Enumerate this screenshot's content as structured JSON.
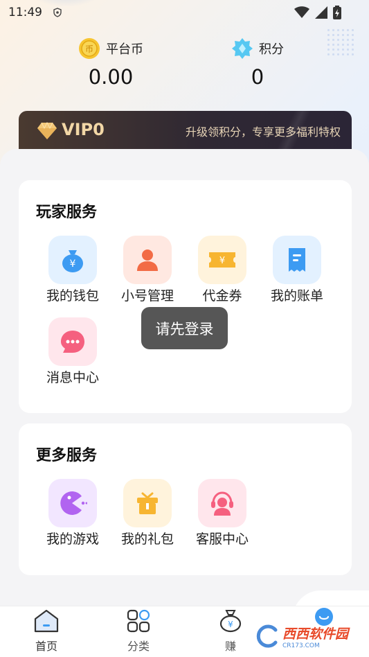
{
  "status_bar": {
    "time": "11:49"
  },
  "stats": {
    "coins": {
      "label": "平台币",
      "value": "0.00",
      "icon": "coin-icon"
    },
    "points": {
      "label": "积分",
      "value": "0",
      "icon": "diamond-badge-icon"
    }
  },
  "vip": {
    "level": "VIP0",
    "slogan": "升级领积分，专享更多福利特权",
    "icon": "diamond-icon"
  },
  "player_services": {
    "title": "玩家服务",
    "items": [
      {
        "label": "我的钱包",
        "icon": "wallet-icon",
        "color": "#e3f1ff"
      },
      {
        "label": "小号管理",
        "icon": "user-icon",
        "color": "#ffe8e1"
      },
      {
        "label": "代金券",
        "icon": "coupon-icon",
        "color": "#fff3dc"
      },
      {
        "label": "我的账单",
        "icon": "bill-icon",
        "color": "#e3f1ff"
      },
      {
        "label": "消息中心",
        "icon": "message-icon",
        "color": "#ffe6ec"
      }
    ]
  },
  "more_services": {
    "title": "更多服务",
    "items": [
      {
        "label": "我的游戏",
        "icon": "game-icon",
        "color": "#f2e6ff"
      },
      {
        "label": "我的礼包",
        "icon": "gift-icon",
        "color": "#fff3dc"
      },
      {
        "label": "客服中心",
        "icon": "headset-icon",
        "color": "#ffe6ec"
      }
    ]
  },
  "toast": {
    "text": "请先登录"
  },
  "tabbar": {
    "tabs": [
      {
        "label": "首页",
        "icon": "home-icon"
      },
      {
        "label": "分类",
        "icon": "category-icon"
      },
      {
        "label": "赚",
        "icon": "money-bag-icon"
      },
      {
        "label": "",
        "icon": "profile-icon"
      }
    ]
  },
  "watermark": {
    "text": "西西软件园",
    "sub": "CR173.COM"
  }
}
